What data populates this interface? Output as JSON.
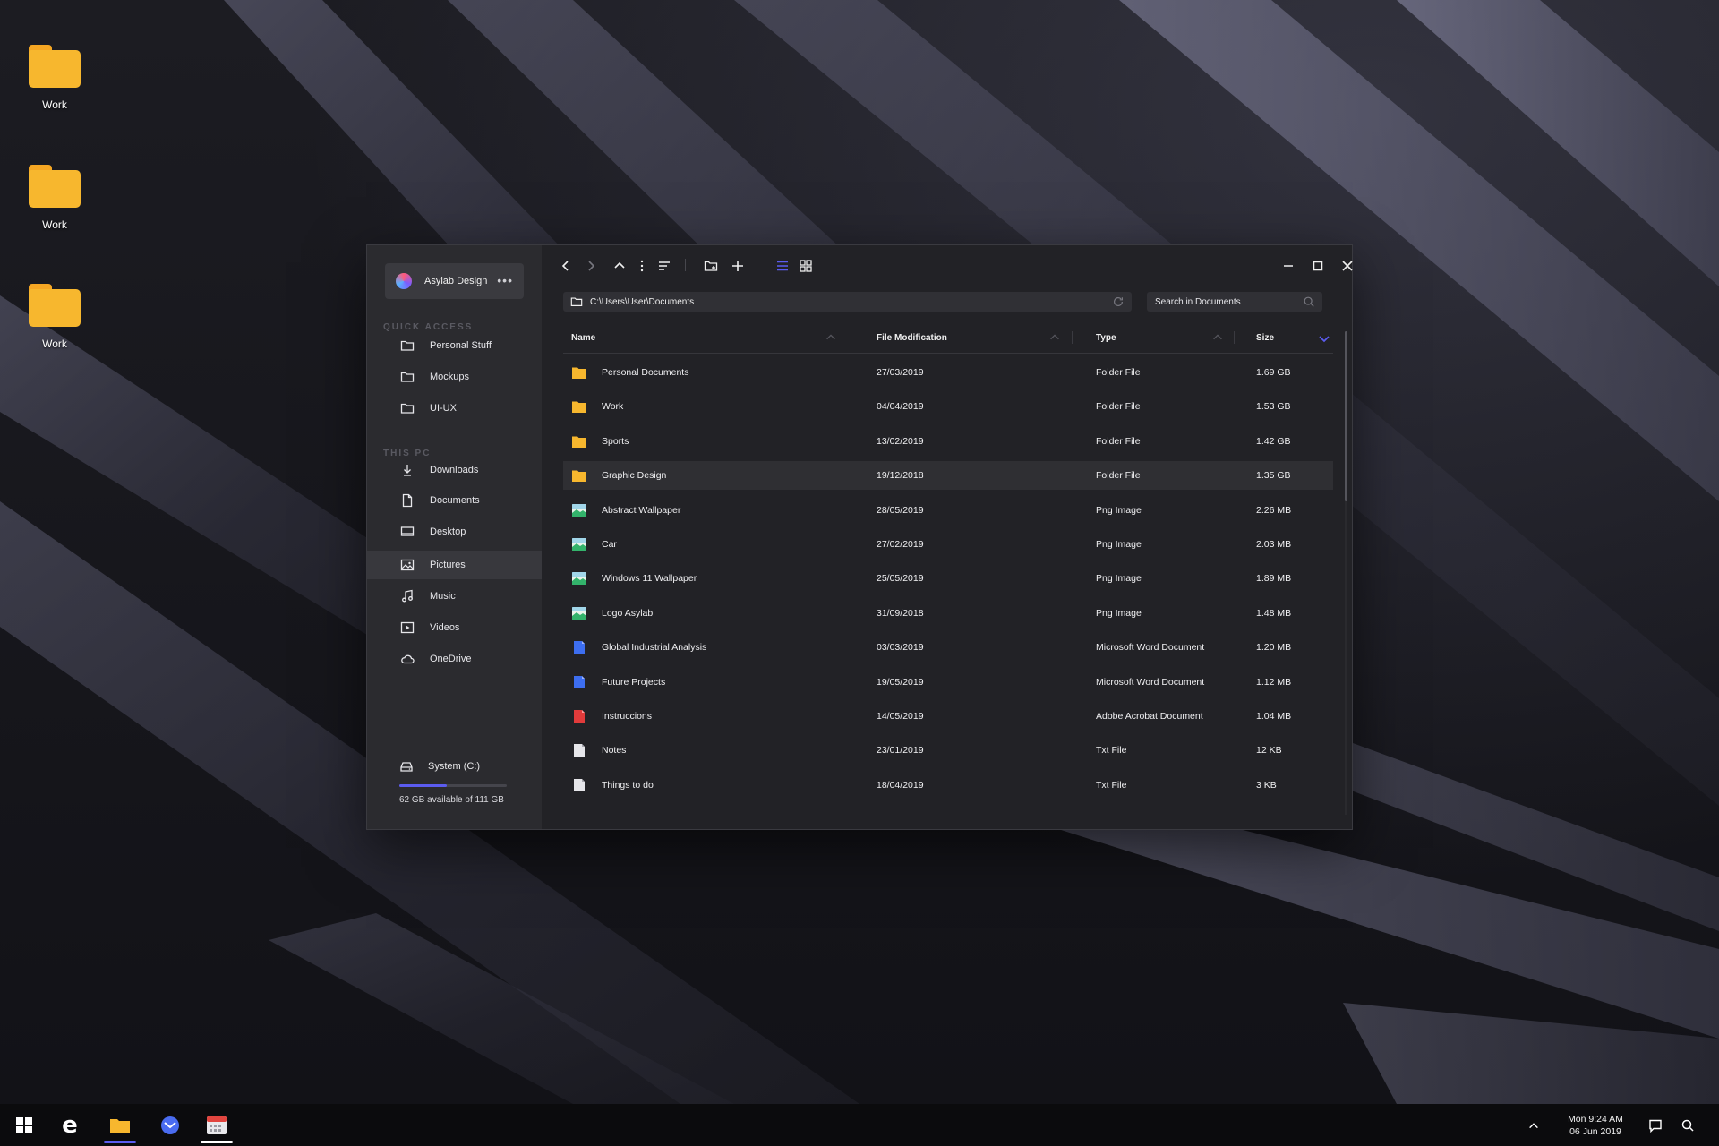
{
  "desktop": {
    "icons": [
      {
        "label": "Work"
      },
      {
        "label": "Work"
      },
      {
        "label": "Work"
      }
    ]
  },
  "window": {
    "account": {
      "name": "Asylab Design",
      "more_icon": "more-horizontal-icon"
    },
    "sidebar": {
      "quick_access_title": "QUICK ACCESS",
      "quick_access": [
        {
          "label": "Personal Stuff",
          "icon": "folder-icon"
        },
        {
          "label": "Mockups",
          "icon": "folder-icon"
        },
        {
          "label": "UI-UX",
          "icon": "folder-icon"
        }
      ],
      "this_pc_title": "THIS PC",
      "this_pc": [
        {
          "label": "Downloads",
          "icon": "download-icon"
        },
        {
          "label": "Documents",
          "icon": "document-icon"
        },
        {
          "label": "Desktop",
          "icon": "desktop-icon"
        },
        {
          "label": "Pictures",
          "icon": "image-icon",
          "active": true
        },
        {
          "label": "Music",
          "icon": "music-icon"
        },
        {
          "label": "Videos",
          "icon": "video-icon"
        },
        {
          "label": "OneDrive",
          "icon": "cloud-icon"
        }
      ],
      "drive": {
        "label": "System (C:)",
        "free_text": "62 GB available of 111 GB",
        "used_fraction": 0.44
      }
    },
    "address": {
      "path": "C:\\Users\\User\\Documents"
    },
    "search": {
      "placeholder": "Search in Documents"
    },
    "columns": {
      "name": "Name",
      "modified": "File Modification",
      "type": "Type",
      "size": "Size"
    },
    "files": [
      {
        "name": "Personal Documents",
        "date": "27/03/2019",
        "type": "Folder File",
        "size": "1.69 GB",
        "kind": "folder"
      },
      {
        "name": "Work",
        "date": "04/04/2019",
        "type": "Folder File",
        "size": "1.53 GB",
        "kind": "folder"
      },
      {
        "name": "Sports",
        "date": "13/02/2019",
        "type": "Folder File",
        "size": "1.42 GB",
        "kind": "folder"
      },
      {
        "name": "Graphic Design",
        "date": "19/12/2018",
        "type": "Folder File",
        "size": "1.35 GB",
        "kind": "folder",
        "selected": true
      },
      {
        "name": "Abstract Wallpaper",
        "date": "28/05/2019",
        "type": "Png Image",
        "size": "2.26 MB",
        "kind": "image"
      },
      {
        "name": "Car",
        "date": "27/02/2019",
        "type": "Png Image",
        "size": "2.03 MB",
        "kind": "image"
      },
      {
        "name": "Windows 11 Wallpaper",
        "date": "25/05/2019",
        "type": "Png Image",
        "size": "1.89 MB",
        "kind": "image"
      },
      {
        "name": "Logo Asylab",
        "date": "31/09/2018",
        "type": "Png Image",
        "size": "1.48 MB",
        "kind": "image"
      },
      {
        "name": "Global Industrial Analysis",
        "date": "03/03/2019",
        "type": "Microsoft Word Document",
        "size": "1.20 MB",
        "kind": "word"
      },
      {
        "name": "Future Projects",
        "date": "19/05/2019",
        "type": "Microsoft Word Document",
        "size": "1.12 MB",
        "kind": "word"
      },
      {
        "name": "Instruccions",
        "date": "14/05/2019",
        "type": "Adobe Acrobat Document",
        "size": "1.04 MB",
        "kind": "pdf"
      },
      {
        "name": "Notes",
        "date": "23/01/2019",
        "type": "Txt File",
        "size": "12 KB",
        "kind": "txt"
      },
      {
        "name": "Things to do",
        "date": "18/04/2019",
        "type": "Txt File",
        "size": "3 KB",
        "kind": "txt"
      }
    ]
  },
  "taskbar": {
    "apps": [
      {
        "name": "start-icon"
      },
      {
        "name": "edge-icon"
      },
      {
        "name": "file-explorer-icon",
        "active": true
      },
      {
        "name": "mail-icon"
      },
      {
        "name": "calendar-icon",
        "open": true
      }
    ],
    "clock": {
      "time": "Mon 9:24 AM",
      "date": "06 Jun 2019"
    }
  },
  "colors": {
    "accent": "#5b5cf0",
    "folder": "#f7b72e",
    "window_bg": "#222226",
    "sidebar_bg": "#2b2b2f"
  }
}
